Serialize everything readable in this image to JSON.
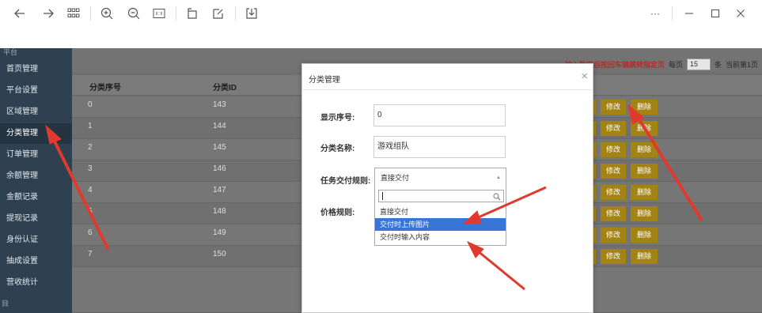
{
  "viewer": {
    "more_label": "···"
  },
  "sidebar": {
    "top_label": "平台",
    "items": [
      {
        "label": "首页管理"
      },
      {
        "label": "平台设置"
      },
      {
        "label": "区域管理"
      },
      {
        "label": "分类管理"
      },
      {
        "label": "订单管理"
      },
      {
        "label": "余额管理"
      },
      {
        "label": "金额记录"
      },
      {
        "label": "提现记录"
      },
      {
        "label": "身份认证"
      },
      {
        "label": "抽成设置"
      },
      {
        "label": "营收统计"
      }
    ],
    "bottom_label": "目"
  },
  "pager": {
    "hint": "输入数字后按回车键跳转指定页",
    "per_page_label": "每页",
    "per_page_value": "15",
    "unit_label": "条",
    "current_label": "当前第1页"
  },
  "table": {
    "headers": [
      "分类序号",
      "分类ID"
    ],
    "rows": [
      {
        "order": "0",
        "id": "143"
      },
      {
        "order": "1",
        "id": "144"
      },
      {
        "order": "2",
        "id": "145"
      },
      {
        "order": "3",
        "id": "146"
      },
      {
        "order": "4",
        "id": "147"
      },
      {
        "order": "5",
        "id": "148"
      },
      {
        "order": "6",
        "id": "149"
      },
      {
        "order": "7",
        "id": "150"
      }
    ],
    "edit_label": "修改",
    "delete_label": "删除"
  },
  "modal": {
    "title": "分类管理",
    "close_label": "×",
    "order_label": "显示序号:",
    "order_value": "0",
    "name_label": "分类名称:",
    "name_value": "游戏组队",
    "rule_label": "任务交付规则:",
    "rule_value": "直接交付",
    "price_label": "价格规则:",
    "options": [
      "直接交付",
      "交付时上传图片",
      "交付时输入内容"
    ]
  },
  "colors": {
    "sidebar_bg": "#2f4050",
    "button_bg": "#a48315",
    "highlight": "#3875d7",
    "arrow": "#e03a2f"
  }
}
